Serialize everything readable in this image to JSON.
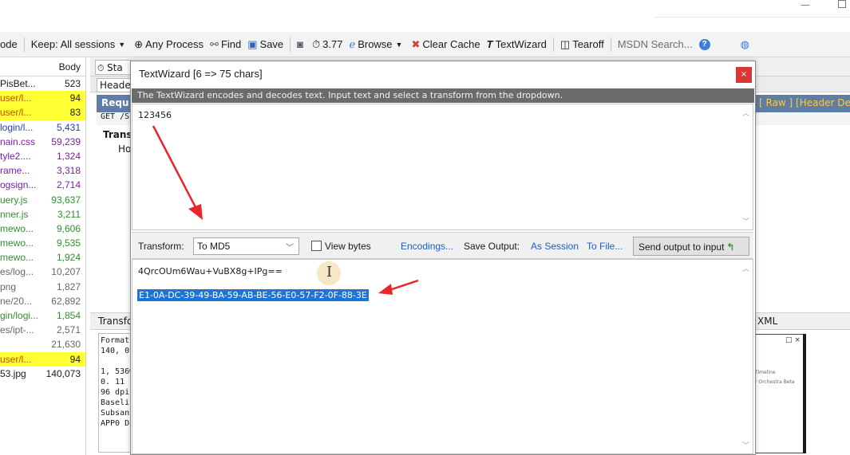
{
  "toolbar": {
    "mode_text": "ode",
    "keep_label": "Keep: All sessions",
    "process_label": "Any Process",
    "find_label": "Find",
    "save_label": "Save",
    "timer_label": "3.77",
    "browse_label": "Browse",
    "clear_cache_label": "Clear Cache",
    "textwizard_label": "TextWizard",
    "tearoff_label": "Tearoff",
    "msdn_label": "MSDN Search..."
  },
  "sessions": {
    "body_header": "Body",
    "rows": [
      {
        "url": "PisBet...",
        "body": "523",
        "color": "#1a1a1a",
        "highlight": false
      },
      {
        "url": "user/l...",
        "body": "94",
        "color": "#d14a00",
        "highlight": true
      },
      {
        "url": "user/l...",
        "body": "83",
        "color": "#d14a00",
        "highlight": true
      },
      {
        "url": "login/l...",
        "body": "5,431",
        "color": "#1f3fbf",
        "highlight": false
      },
      {
        "url": "nain.css",
        "body": "59,239",
        "color": "#7a1fa6",
        "highlight": false
      },
      {
        "url": "tyle2....",
        "body": "1,324",
        "color": "#7a1fa6",
        "highlight": false
      },
      {
        "url": "rame...",
        "body": "3,318",
        "color": "#7a1fa6",
        "highlight": false
      },
      {
        "url": "ogsign...",
        "body": "2,714",
        "color": "#7a1fa6",
        "highlight": false
      },
      {
        "url": "uery.js",
        "body": "93,637",
        "color": "#2f8f2f",
        "highlight": false
      },
      {
        "url": "nner.js",
        "body": "3,211",
        "color": "#2f8f2f",
        "highlight": false
      },
      {
        "url": "mewo...",
        "body": "9,606",
        "color": "#2f8f2f",
        "highlight": false
      },
      {
        "url": "mewo...",
        "body": "9,535",
        "color": "#2f8f2f",
        "highlight": false
      },
      {
        "url": "mewo...",
        "body": "1,924",
        "color": "#2f8f2f",
        "highlight": false
      },
      {
        "url": "es/log...",
        "body": "10,207",
        "color": "#666666",
        "highlight": false
      },
      {
        "url": "png",
        "body": "1,827",
        "color": "#666666",
        "highlight": false
      },
      {
        "url": "ne/20...",
        "body": "62,892",
        "color": "#666666",
        "highlight": false
      },
      {
        "url": "gin/logi...",
        "body": "1,854",
        "color": "#2f8f2f",
        "highlight": false
      },
      {
        "url": "es/ipt-...",
        "body": "2,571",
        "color": "#666666",
        "highlight": false
      },
      {
        "url": "",
        "body": "21,630",
        "color": "#666666",
        "highlight": false
      },
      {
        "url": "user/l...",
        "body": "94",
        "color": "#d14a00",
        "highlight": true
      },
      {
        "url": "53.jpg",
        "body": "140,073",
        "color": "#1a1a1a",
        "highlight": false
      }
    ]
  },
  "inspectors": {
    "tab_statistics": "Sta",
    "tab_headers": "Header",
    "request_label": "Requ",
    "raw_links": "[ Raw ]   [Header De",
    "get_line": "GET /S",
    "transfer_label": "Trans",
    "host_label": "Ho",
    "lower_tab": "Transfo",
    "lower_xml": "XML",
    "lower_text": "Format\n140, 07\n\n1, 536w\n0. 11 k\n96 dpi\nBaseli\nSubsan\nAPP0 Data (14",
    "thumb_text_1": "Timeline",
    "thumb_text_2": "r Orchestra Beta"
  },
  "dialog": {
    "title": "TextWizard [6 => 75 chars]",
    "close_label": "×",
    "description": "The TextWizard encodes and decodes text. Input text and select a transform from the dropdown.",
    "input_value": "123456",
    "transform_label": "Transform:",
    "transform_value": "To MD5",
    "view_bytes_label": "View bytes",
    "encodings_link": "Encodings...",
    "save_output_label": "Save Output:",
    "as_session_link": "As Session",
    "to_file_link": "To File...",
    "send_output_label": "Send output to input",
    "output_base64": "4QrcOUm6Wau+VuBX8g+IPg==",
    "output_hex": "E1-0A-DC-39-49-BA-59-AB-BE-56-E0-57-F2-0F-88-3E"
  },
  "colors": {
    "annotation_arrow": "#e8262b",
    "selection": "#1d74d6",
    "link": "#1a5fc7",
    "close_button": "#d93737",
    "description_bar": "#6b6b6b"
  }
}
